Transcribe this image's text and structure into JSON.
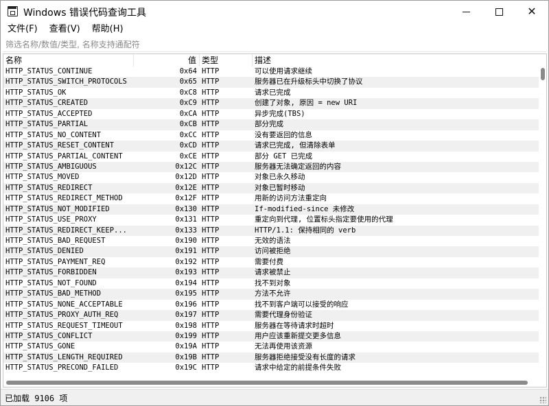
{
  "window": {
    "title": "Windows 错误代码查询工具"
  },
  "menu": [
    "文件(F)",
    "查看(V)",
    "帮助(H)"
  ],
  "filter": {
    "placeholder": "筛选名称/数值/类型, 名称支持通配符",
    "value": ""
  },
  "columns": [
    "名称",
    "值",
    "类型",
    "描述"
  ],
  "rows": [
    [
      "HTTP_STATUS_CONTINUE",
      "0x64",
      "HTTP",
      "可以使用请求继续"
    ],
    [
      "HTTP_STATUS_SWITCH_PROTOCOLS",
      "0x65",
      "HTTP",
      "服务器已在升级标头中切换了协议"
    ],
    [
      "HTTP_STATUS_OK",
      "0xC8",
      "HTTP",
      "请求已完成"
    ],
    [
      "HTTP_STATUS_CREATED",
      "0xC9",
      "HTTP",
      "创建了对象, 原因 = new URI"
    ],
    [
      "HTTP_STATUS_ACCEPTED",
      "0xCA",
      "HTTP",
      "异步完成(TBS)"
    ],
    [
      "HTTP_STATUS_PARTIAL",
      "0xCB",
      "HTTP",
      "部分完成"
    ],
    [
      "HTTP_STATUS_NO_CONTENT",
      "0xCC",
      "HTTP",
      "没有要返回的信息"
    ],
    [
      "HTTP_STATUS_RESET_CONTENT",
      "0xCD",
      "HTTP",
      "请求已完成, 但清除表单"
    ],
    [
      "HTTP_STATUS_PARTIAL_CONTENT",
      "0xCE",
      "HTTP",
      "部分 GET 已完成"
    ],
    [
      "HTTP_STATUS_AMBIGUOUS",
      "0x12C",
      "HTTP",
      "服务器无法确定返回的内容"
    ],
    [
      "HTTP_STATUS_MOVED",
      "0x12D",
      "HTTP",
      "对象已永久移动"
    ],
    [
      "HTTP_STATUS_REDIRECT",
      "0x12E",
      "HTTP",
      "对象已暂时移动"
    ],
    [
      "HTTP_STATUS_REDIRECT_METHOD",
      "0x12F",
      "HTTP",
      "用新的访问方法重定向"
    ],
    [
      "HTTP_STATUS_NOT_MODIFIED",
      "0x130",
      "HTTP",
      "If-modified-since 未修改"
    ],
    [
      "HTTP_STATUS_USE_PROXY",
      "0x131",
      "HTTP",
      "重定向到代理, 位置标头指定要使用的代理"
    ],
    [
      "HTTP_STATUS_REDIRECT_KEEP...",
      "0x133",
      "HTTP",
      "HTTP/1.1: 保持相同的 verb"
    ],
    [
      "HTTP_STATUS_BAD_REQUEST",
      "0x190",
      "HTTP",
      "无效的语法"
    ],
    [
      "HTTP_STATUS_DENIED",
      "0x191",
      "HTTP",
      "访问被拒绝"
    ],
    [
      "HTTP_STATUS_PAYMENT_REQ",
      "0x192",
      "HTTP",
      "需要付费"
    ],
    [
      "HTTP_STATUS_FORBIDDEN",
      "0x193",
      "HTTP",
      "请求被禁止"
    ],
    [
      "HTTP_STATUS_NOT_FOUND",
      "0x194",
      "HTTP",
      "找不到对象"
    ],
    [
      "HTTP_STATUS_BAD_METHOD",
      "0x195",
      "HTTP",
      "方法不允许"
    ],
    [
      "HTTP_STATUS_NONE_ACCEPTABLE",
      "0x196",
      "HTTP",
      "找不到客户端可以接受的响应"
    ],
    [
      "HTTP_STATUS_PROXY_AUTH_REQ",
      "0x197",
      "HTTP",
      "需要代理身份验证"
    ],
    [
      "HTTP_STATUS_REQUEST_TIMEOUT",
      "0x198",
      "HTTP",
      "服务器在等待请求时超时"
    ],
    [
      "HTTP_STATUS_CONFLICT",
      "0x199",
      "HTTP",
      "用户应该重新提交更多信息"
    ],
    [
      "HTTP_STATUS_GONE",
      "0x19A",
      "HTTP",
      "无法再使用该资源"
    ],
    [
      "HTTP_STATUS_LENGTH_REQUIRED",
      "0x19B",
      "HTTP",
      "服务器拒绝接受没有长度的请求"
    ],
    [
      "HTTP_STATUS_PRECOND_FAILED",
      "0x19C",
      "HTTP",
      "请求中给定的前提条件失败"
    ]
  ],
  "status": {
    "text": "已加载 9106 项"
  },
  "icons": {
    "app": "app-window-icon",
    "minimize": "minimize-icon",
    "maximize": "maximize-icon",
    "close": "close-icon",
    "resize": "resize-grip-icon"
  },
  "colors": {
    "row_alt": "#f0f0f0",
    "scroll_thumb": "#8a8a8a",
    "statusbar": "#f0f0f0"
  }
}
